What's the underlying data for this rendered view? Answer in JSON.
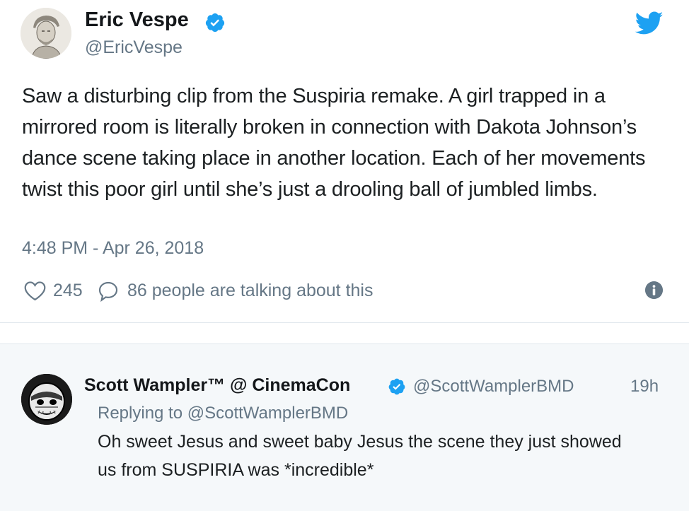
{
  "tweet": {
    "author_name": "Eric Vespe",
    "handle": "@EricVespe",
    "text": "Saw a disturbing clip from the Suspiria remake. A girl trapped in a mirrored room is literally broken in connection with Dakota Johnson’s dance scene taking place in another location. Each of her movements twist this poor girl until she’s just a drooling ball of jumbled limbs.",
    "timestamp": "4:48 PM - Apr 26, 2018",
    "likes": "245",
    "talking": "86 people are talking about this"
  },
  "reply": {
    "author_name": "Scott Wampler™ @ CinemaCon",
    "handle": "@ScottWamplerBMD",
    "time": "19h",
    "replying_to": "Replying to @ScottWamplerBMD",
    "text": "Oh sweet Jesus and sweet baby Jesus the scene they just showed us from SUSPIRIA was *incredible*"
  },
  "icons": {
    "verified": "verified-badge-icon",
    "brand": "twitter-bird-icon",
    "like": "heart-icon",
    "reply": "speech-bubble-icon",
    "info": "info-icon"
  },
  "colors": {
    "twitter_blue": "#1da1f2",
    "secondary_text": "#657786",
    "reply_background": "#f5f8fa"
  }
}
